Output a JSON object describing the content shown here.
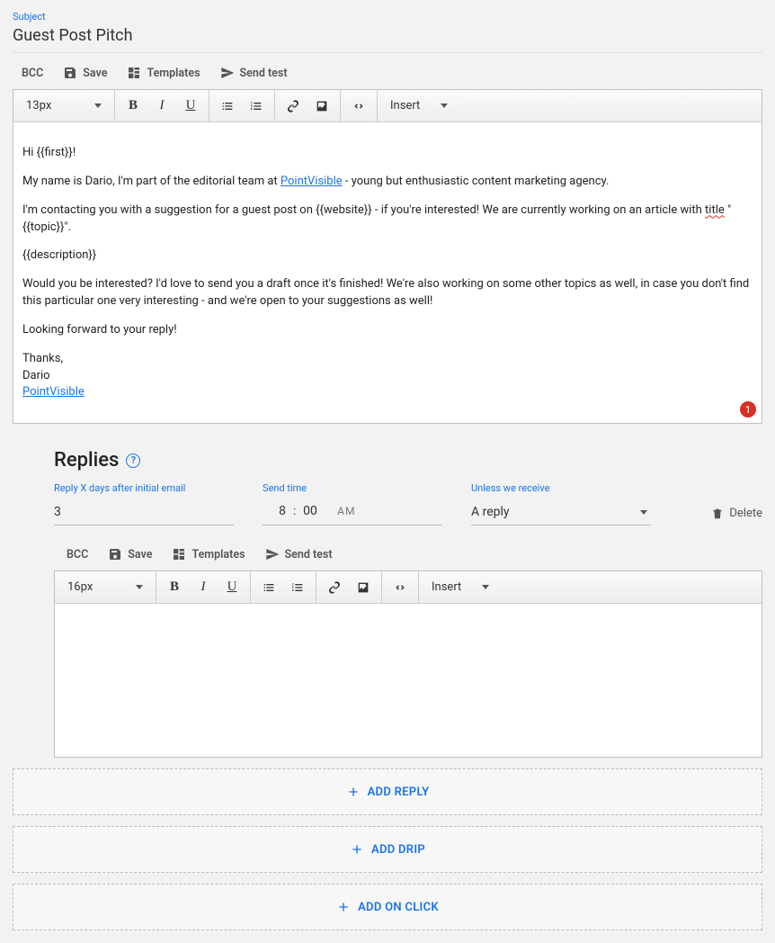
{
  "subject": {
    "label": "Subject",
    "value": "Guest Post Pitch"
  },
  "actions": {
    "bcc": "BCC",
    "save": "Save",
    "templates": "Templates",
    "send_test": "Send test"
  },
  "editor_main": {
    "font_size": "13px",
    "insert_label": "Insert",
    "badge": "1",
    "body": {
      "greeting": "Hi {{first}}!",
      "intro_pre": "My name is Dario, I'm part of the editorial team at ",
      "intro_link": "PointVisible",
      "intro_post": " - young but enthusiastic content marketing agency.",
      "pitch_pre": "I'm contacting you with a suggestion for a guest post on {{website}} - if you're interested! We are currently working on an article with ",
      "pitch_title_word": "title",
      "pitch_topic": " \"{{topic}}\".",
      "description": "{{description}}",
      "ask": "Would you be interested? I'd love to send you a draft once it's finished! We're also working on some other topics as well, in case you don't find this particular one very interesting - and we're open to your suggestions as well!",
      "closing": "Looking forward to your reply!",
      "thanks": "Thanks,",
      "name": "Dario",
      "sig_link": "PointVisible"
    }
  },
  "replies": {
    "header": "Replies",
    "fields": {
      "days_label": "Reply X days after initial email",
      "days_value": "3",
      "send_time_label": "Send time",
      "hour": "8",
      "minute": "00",
      "ampm": "AM",
      "unless_label": "Unless we receive",
      "unless_value": "A reply"
    },
    "delete_label": "Delete",
    "editor": {
      "font_size": "16px",
      "insert_label": "Insert"
    }
  },
  "add_buttons": {
    "reply": "ADD REPLY",
    "drip": "ADD DRIP",
    "onclick": "ADD ON CLICK"
  }
}
